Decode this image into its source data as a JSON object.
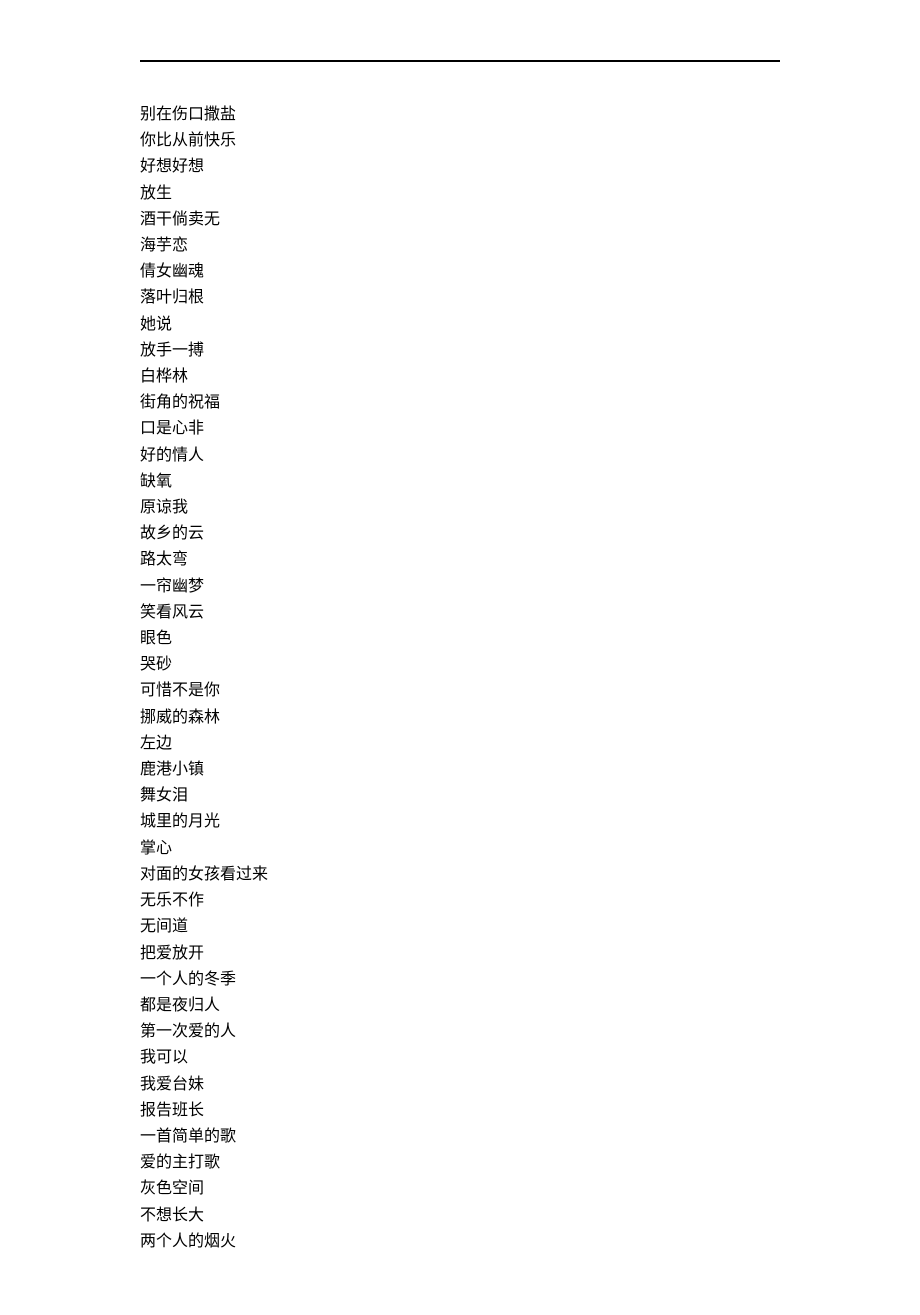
{
  "songs": [
    "别在伤口撒盐",
    "你比从前快乐",
    "好想好想",
    "放生",
    "酒干倘卖无",
    "海芋恋",
    "倩女幽魂",
    "落叶归根",
    "她说",
    "放手一搏",
    "白桦林",
    "街角的祝福",
    "口是心非",
    "好的情人",
    "缺氧",
    "原谅我",
    "故乡的云",
    "路太弯",
    "一帘幽梦",
    "笑看风云",
    "眼色",
    "哭砂",
    "可惜不是你",
    "挪威的森林",
    "左边",
    "鹿港小镇",
    "舞女泪",
    "城里的月光",
    "掌心",
    "对面的女孩看过来",
    "无乐不作",
    "无间道",
    "把爱放开",
    "一个人的冬季",
    "都是夜归人",
    "第一次爱的人",
    "我可以",
    "我爱台妹",
    "报告班长",
    "一首简单的歌",
    "爱的主打歌",
    "灰色空间",
    "不想长大",
    "两个人的烟火"
  ]
}
